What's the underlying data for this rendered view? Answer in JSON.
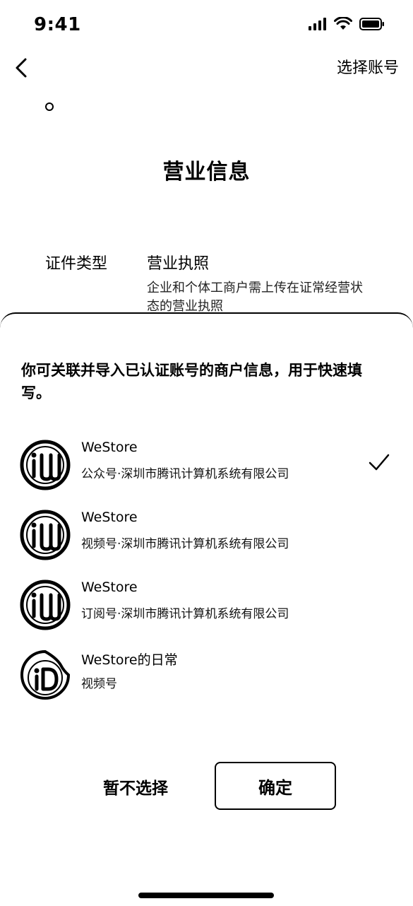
{
  "status": {
    "time": "9:41"
  },
  "nav": {
    "action": "选择账号"
  },
  "page": {
    "title": "营业信息",
    "field_label": "证件类型",
    "field_value": "营业执照",
    "field_hint": "企业和个体工商户需上传在证常经营状态的营业执照"
  },
  "sheet": {
    "description": "你可关联并导入已认证账号的商户信息，用于快速填写。",
    "accounts": [
      {
        "name": "WeStore",
        "subtitle": "公众号·深圳市腾讯计算机系统有限公司",
        "selected": true
      },
      {
        "name": "WeStore",
        "subtitle": "视频号·深圳市腾讯计算机系统有限公司",
        "selected": false
      },
      {
        "name": "WeStore",
        "subtitle": "订阅号·深圳市腾讯计算机系统有限公司",
        "selected": false
      },
      {
        "name": "WeStore的日常",
        "subtitle": "视频号",
        "selected": false
      }
    ],
    "skip_label": "暂不选择",
    "confirm_label": "确定"
  },
  "icons": {
    "back": "chevron-left-icon",
    "check": "check-icon",
    "signal": "cellular-signal-icon",
    "wifi": "wifi-icon",
    "battery": "battery-icon"
  }
}
